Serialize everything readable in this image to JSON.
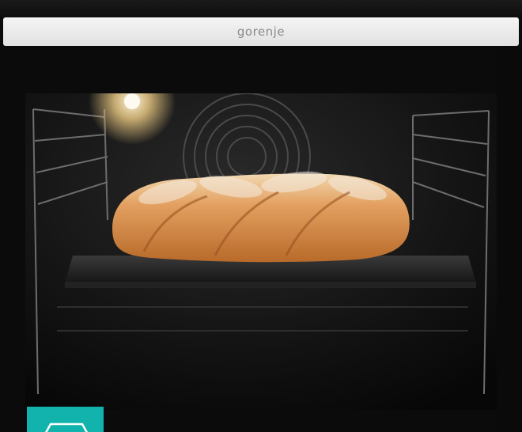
{
  "brand": {
    "name": "gorenje"
  },
  "colors": {
    "badge": "#12b3ad",
    "panel": "#ebebeb"
  },
  "icons": {
    "badge_icon": "tray-outline-icon"
  }
}
